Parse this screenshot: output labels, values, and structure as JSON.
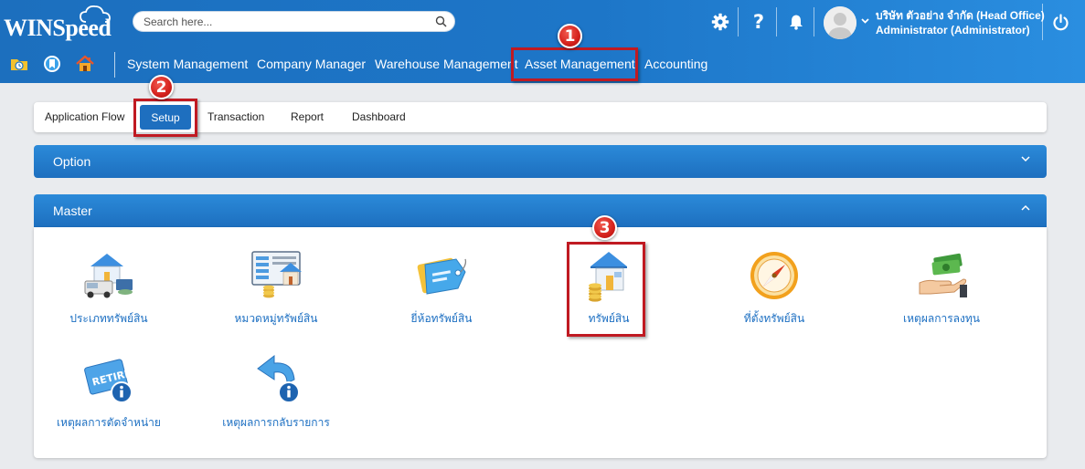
{
  "app": {
    "logo_text": "WINSpeed"
  },
  "search": {
    "placeholder": "Search here..."
  },
  "user": {
    "company": "บริษัท ตัวอย่าง จำกัด (Head Office)",
    "role": "Administrator (Administrator)"
  },
  "header_icons": [
    "gear-icon",
    "help-icon",
    "bell-icon",
    "chevron-down-icon",
    "power-icon"
  ],
  "shortcuts": [
    "folder-clock-icon",
    "bookmark-icon",
    "home-icon"
  ],
  "menu": [
    {
      "label": "System Management"
    },
    {
      "label": "Company Manager"
    },
    {
      "label": "Warehouse Management"
    },
    {
      "label": "Asset Management"
    },
    {
      "label": "Accounting"
    }
  ],
  "tabs": [
    {
      "label": "Application Flow"
    },
    {
      "label": "Setup"
    },
    {
      "label": "Transaction"
    },
    {
      "label": "Report"
    },
    {
      "label": "Dashboard"
    }
  ],
  "panels": {
    "option": {
      "title": "Option"
    },
    "master": {
      "title": "Master"
    }
  },
  "master_items": [
    {
      "label": "ประเภททรัพย์สิน",
      "icon": "asset-type-icon"
    },
    {
      "label": "หมวดหมู่ทรัพย์สิน",
      "icon": "asset-category-icon"
    },
    {
      "label": "ยี่ห้อทรัพย์สิน",
      "icon": "asset-brand-tag-icon"
    },
    {
      "label": "ทรัพย์สิน",
      "icon": "asset-house-coins-icon"
    },
    {
      "label": "ที่ตั้งทรัพย์สิน",
      "icon": "compass-icon"
    },
    {
      "label": "เหตุผลการลงทุน",
      "icon": "money-hand-icon"
    },
    {
      "label": "เหตุผลการตัดจำหน่าย",
      "icon": "retire-info-icon"
    },
    {
      "label": "เหตุผลการกลับรายการ",
      "icon": "reverse-info-icon"
    }
  ],
  "callouts": [
    "1",
    "2",
    "3"
  ],
  "colors": {
    "header": "#1d76c8",
    "accent_red": "#c01a22",
    "link": "#1c6fc2"
  }
}
